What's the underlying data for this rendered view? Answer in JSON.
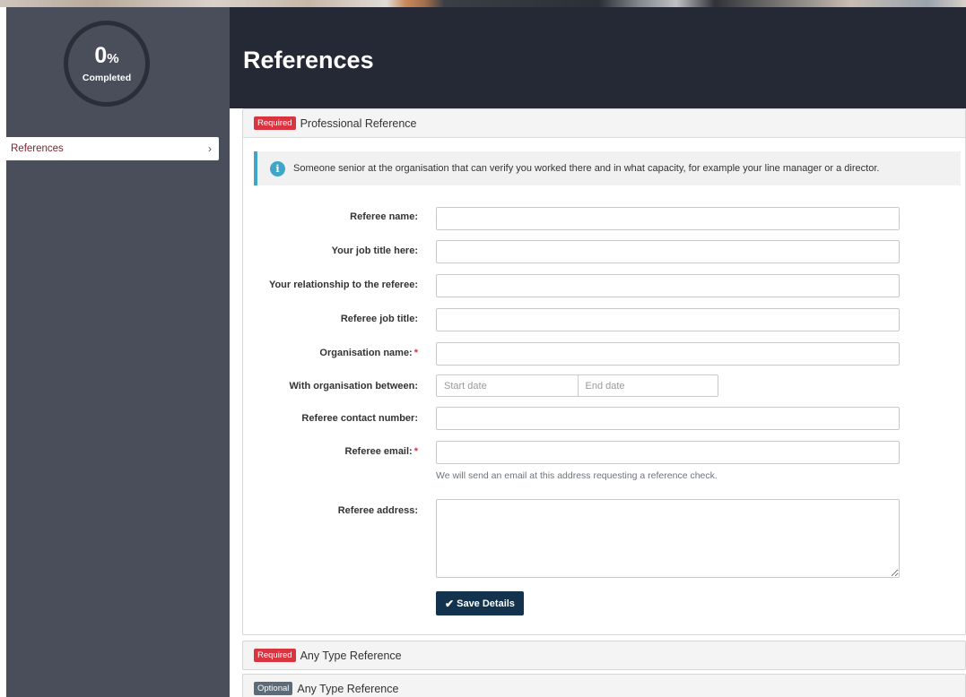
{
  "sidebar": {
    "progress": {
      "value": "0",
      "unit": "%",
      "label": "Completed"
    },
    "items": [
      {
        "label": "References"
      }
    ]
  },
  "header": {
    "title": "References"
  },
  "main_card": {
    "badge": "Required",
    "title": "Professional Reference",
    "info": "Someone senior at the organisation that can verify you worked there and in what capacity, for example your line manager or a director.",
    "fields": {
      "referee_name": {
        "label": "Referee name:",
        "value": ""
      },
      "job_title": {
        "label": "Your job title here:",
        "value": ""
      },
      "relationship": {
        "label": "Your relationship to the referee:",
        "value": ""
      },
      "referee_job_title": {
        "label": "Referee job title:",
        "value": ""
      },
      "organisation_name": {
        "label": "Organisation name:",
        "required_mark": "*",
        "value": ""
      },
      "organisation_between": {
        "label": "With organisation between:",
        "start_placeholder": "Start date",
        "end_placeholder": "End date"
      },
      "contact_number": {
        "label": "Referee contact number:",
        "value": ""
      },
      "email": {
        "label": "Referee email:",
        "required_mark": "*",
        "value": "",
        "help": "We will send an email at this address requesting a reference check."
      },
      "address": {
        "label": "Referee address:",
        "value": ""
      }
    },
    "save_label": "Save Details"
  },
  "collapsed_cards": [
    {
      "badge": "Required",
      "title": "Any Type Reference"
    },
    {
      "badge": "Optional",
      "title": "Any Type Reference"
    }
  ],
  "colors": {
    "sidebar_bg": "#4a4d5a",
    "header_bg": "#252936",
    "required_badge": "#d9343f",
    "optional_badge": "#5c6b78",
    "info_accent": "#3fa6c8",
    "primary_button": "#12324d",
    "active_nav_text": "#8a1f2b"
  },
  "icons": [
    "info-icon",
    "chevron-right-icon",
    "check-icon"
  ]
}
